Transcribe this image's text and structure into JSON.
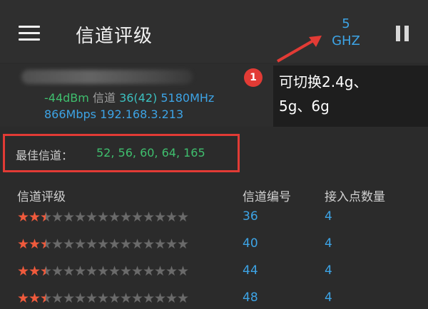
{
  "appbar": {
    "title": "信道评级",
    "band_number": "5",
    "band_unit": "GHZ"
  },
  "connection": {
    "signal": "-44dBm",
    "channel_label": "信道",
    "channel_value": "36(42)",
    "frequency": "5180MHz",
    "link_speed": "866Mbps",
    "ip": "192.168.3.213"
  },
  "annotation": {
    "badge": "1",
    "tooltip_line1": "可切换2.4g、",
    "tooltip_line2": "5g、6g"
  },
  "best": {
    "label": "最佳信道：",
    "values": "52, 56, 60, 64, 165"
  },
  "columns": {
    "rating": "信道评级",
    "channel": "信道编号",
    "ap_count": "接入点数量"
  },
  "rows": [
    {
      "rating": 2.5,
      "channel": "36",
      "ap_count": "4"
    },
    {
      "rating": 2.5,
      "channel": "40",
      "ap_count": "4"
    },
    {
      "rating": 2.5,
      "channel": "44",
      "ap_count": "4"
    },
    {
      "rating": 2.5,
      "channel": "48",
      "ap_count": "4"
    }
  ],
  "rating_max": 15,
  "colors": {
    "accent": "#3da4e6",
    "good": "#3fbf6e",
    "highlight": "#e23b35",
    "star": "#f05a3c"
  }
}
